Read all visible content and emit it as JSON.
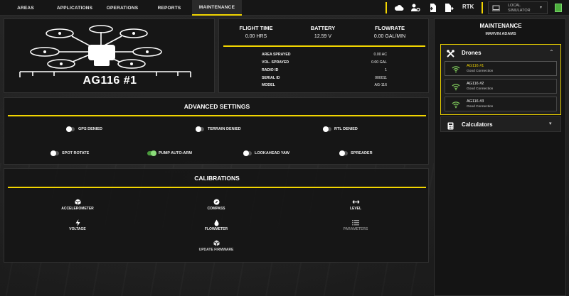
{
  "nav": {
    "tabs": [
      "AREAS",
      "APPLICATIONS",
      "OPERATIONS",
      "REPORTS",
      "MAINTENANCE"
    ],
    "active_tab": "MAINTENANCE",
    "rtk_label": "RTK",
    "simulator_label_line1": "LOCAL",
    "simulator_label_line2": "SIMULATOR",
    "status_color": "#4caf3d"
  },
  "drone": {
    "name": "AG116 #1"
  },
  "stats": {
    "flight_time": {
      "label": "FLIGHT TIME",
      "value": "0.00 HRS"
    },
    "battery": {
      "label": "BATTERY",
      "value": "12.59 V"
    },
    "flowrate": {
      "label": "FLOWRATE",
      "value": "0.00 GAL/MIN"
    }
  },
  "details": [
    {
      "label": "AREA SPRAYED",
      "value": "0.00 AC"
    },
    {
      "label": "VOL. SPRAYED",
      "value": "0.00 GAL"
    },
    {
      "label": "RADIO ID",
      "value": "1"
    },
    {
      "label": "SERIAL ID",
      "value": "000011"
    },
    {
      "label": "MODEL",
      "value": "AG-116"
    }
  ],
  "advanced": {
    "title": "ADVANCED SETTINGS",
    "toggles": [
      {
        "label": "GPS DENIED",
        "on": false
      },
      {
        "label": "TERRAIN DENIED",
        "on": false
      },
      {
        "label": "RTL DENIED",
        "on": false
      },
      {
        "label": "SPOT ROTATE",
        "on": false
      },
      {
        "label": "PUMP AUTO-ARM",
        "on": true
      },
      {
        "label": "LOOKAHEAD YAW",
        "on": false
      },
      {
        "label": "SPREADER",
        "on": false
      }
    ]
  },
  "calibrations": {
    "title": "CALIBRATIONS",
    "items": [
      {
        "label": "ACCELEROMETER",
        "icon": "cube-icon",
        "enabled": true
      },
      {
        "label": "COMPASS",
        "icon": "compass-icon",
        "enabled": true
      },
      {
        "label": "LEVEL",
        "icon": "arrows-horizontal-icon",
        "enabled": true
      },
      {
        "label": "VOLTAGE",
        "icon": "bolt-icon",
        "enabled": true
      },
      {
        "label": "FLOWMETER",
        "icon": "droplet-icon",
        "enabled": true
      },
      {
        "label": "PARAMETERS",
        "icon": "list-icon",
        "enabled": false
      },
      {
        "label": "UPDATE FIRMWARE",
        "icon": "cube-icon",
        "enabled": true
      }
    ]
  },
  "sidebar": {
    "title": "MAINTENANCE",
    "user": "MARVIN ADAMS",
    "drones_header": "Drones",
    "drones": [
      {
        "name": "AG116 #1",
        "status": "Good Connection",
        "active": true
      },
      {
        "name": "AG116 #2",
        "status": "Good Connection",
        "active": false
      },
      {
        "name": "AG116 #3",
        "status": "Good Connection",
        "active": false
      }
    ],
    "calculators_header": "Calculators"
  },
  "colors": {
    "accent": "#f2d500",
    "toggle_on": "#4a9a3c",
    "wifi_green": "#7ec85a"
  }
}
